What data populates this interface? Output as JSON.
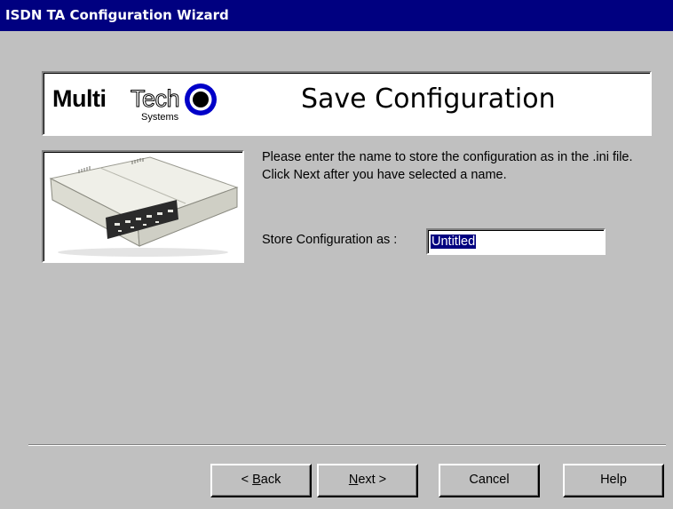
{
  "window": {
    "title": "ISDN TA Configuration Wizard"
  },
  "banner": {
    "logo_multi": "Multi",
    "logo_tech": "Tech",
    "logo_systems": "Systems",
    "title": "Save Configuration"
  },
  "content": {
    "instructions": "Please enter the name to store the configuration as in the .ini file.  Click Next after you have selected a name.",
    "field_label": "Store Configuration as :",
    "field_value": "Untitled"
  },
  "buttons": {
    "back": {
      "prefix": "< ",
      "accel": "B",
      "rest": "ack"
    },
    "next": {
      "accel": "N",
      "rest": "ext >"
    },
    "cancel": "Cancel",
    "help": "Help"
  },
  "colors": {
    "titlebar": "#000080",
    "face": "#c0c0c0",
    "logo_ring": "#0000c8"
  }
}
